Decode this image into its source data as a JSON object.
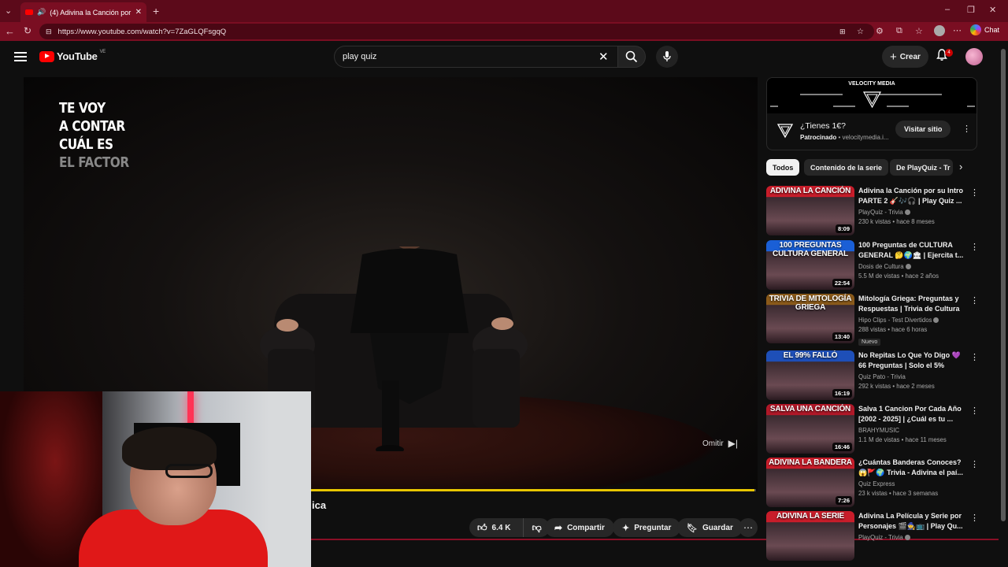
{
  "browser": {
    "tab_title": "(4) Adivina la Canción por su",
    "url": "https://www.youtube.com/watch?v=7ZaGLQFsgqQ",
    "chat_label": "Chat",
    "accent": "#7a0e22"
  },
  "header": {
    "logo_text": "YouTube",
    "country": "VE",
    "search_value": "play quiz",
    "create_label": "Crear",
    "notification_count": "4"
  },
  "player": {
    "overlay_lines": [
      "TE VOY",
      "A CONTAR",
      "CUÁL ES",
      "EL FACTOR"
    ],
    "skip_label": "Omitir",
    "progress": 0.998
  },
  "below_video": {
    "title_fragment": "ica",
    "likes": "6.4 K",
    "share_label": "Compartir",
    "ask_label": "Preguntar",
    "save_label": "Guardar"
  },
  "ad": {
    "brand": "VELOCITY MEDIA",
    "title": "¿Tienes 1€?",
    "sponsored": "Patrocinado",
    "domain": "velocitymedia.i...",
    "visit_label": "Visitar sitio"
  },
  "chips": [
    "Todos",
    "Contenido de la serie",
    "De PlayQuiz - Tr"
  ],
  "recommendations": [
    {
      "thumb_caption": "ADIVINA LA CANCIÓN",
      "thumb_color": "#c81d2a",
      "duration": "8:09",
      "title": "Adivina la Canción por su Intro PARTE 2 🎸🎶🎧 | Play Quiz ...",
      "channel": "PlayQuiz - Trivia",
      "verified": true,
      "meta": "230 k vistas • hace 8 meses",
      "badge": ""
    },
    {
      "thumb_caption": "100 PREGUNTAS CULTURA GENERAL",
      "thumb_color": "#1a5fd6",
      "duration": "22:54",
      "title": "100 Preguntas de CULTURA GENERAL 🤔🌍🏛 | Ejercita t...",
      "channel": "Dosis de Cultura",
      "verified": true,
      "meta": "5.5 M de vistas • hace 2 años",
      "badge": ""
    },
    {
      "thumb_caption": "TRIVIA DE MITOLOGÍA GRIEGA",
      "thumb_color": "#8a5a1a",
      "duration": "13:40",
      "title": "Mitología Griega: Preguntas y Respuestas | Trivia de Cultura ...",
      "channel": "Hipo Clips - Test Divertidos",
      "verified": true,
      "meta": "288 vistas • hace 6 horas",
      "badge": "Nuevo"
    },
    {
      "thumb_caption": "EL 99% FALLÓ",
      "thumb_color": "#1e4fb8",
      "duration": "16:19",
      "title": "No Repitas Lo Que Yo Digo 💜 66 Preguntas | Solo el 5% Lleg...",
      "channel": "Quiz Pato - Trivia",
      "verified": false,
      "meta": "292 k vistas • hace 2 meses",
      "badge": ""
    },
    {
      "thumb_caption": "SALVA UNA CANCIÓN",
      "thumb_color": "#b01828",
      "duration": "16:46",
      "title": "Salva 1 Cancion Por Cada Año [2002 - 2025] | ¿Cuál es tu ...",
      "channel": "BRAHYMUSIC",
      "verified": false,
      "meta": "1.1 M de vistas • hace 11 meses",
      "badge": ""
    },
    {
      "thumb_caption": "ADIVINA LA BANDERA",
      "thumb_color": "#c81d2a",
      "duration": "7:26",
      "title": "¿Cuántas Banderas Conoces? 😱🚩🌍 Trivia - Adivina el paí...",
      "channel": "Quiz Express",
      "verified": false,
      "meta": "23 k vistas • hace 3 semanas",
      "badge": ""
    },
    {
      "thumb_caption": "ADIVINA LA SERIE",
      "thumb_color": "#c81d2a",
      "duration": "",
      "title": "Adivina La Película y Serie por Personajes 🎬🧙📺 | Play Qu...",
      "channel": "PlayQuiz - Trivia",
      "verified": true,
      "meta": "",
      "badge": ""
    }
  ]
}
